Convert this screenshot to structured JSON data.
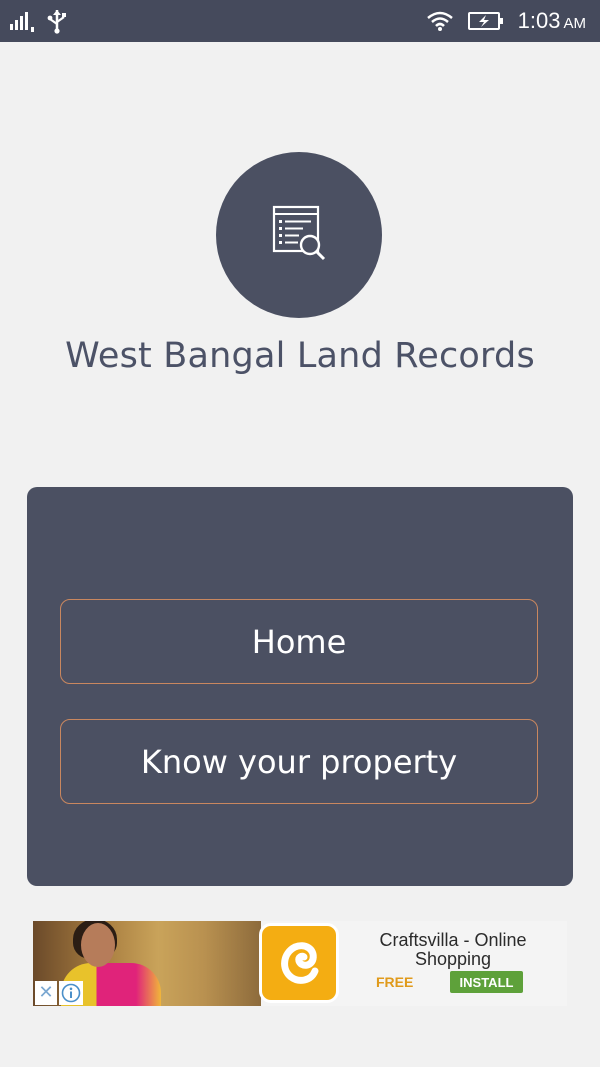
{
  "status_bar": {
    "time": "1:03",
    "ampm": "AM",
    "icons": [
      "signal-icon",
      "usb-icon",
      "wifi-icon",
      "battery-charging-icon"
    ]
  },
  "app": {
    "title": "West Bangal Land Records",
    "logo_icon": "document-search-icon"
  },
  "menu": {
    "home_label": "Home",
    "property_label": "Know your property"
  },
  "ad": {
    "app_name": "Craftsvilla - Online Shopping",
    "price": "FREE",
    "install_label": "INSTALL",
    "close_icon": "close-icon",
    "info_icon": "info-icon"
  },
  "colors": {
    "status_bar": "#454a5c",
    "card": "#4b5062",
    "button_border": "#c9875f",
    "title_text": "#4c5267",
    "background": "#f1f1f1",
    "install_button": "#5ea13a",
    "free_text": "#e09a1b"
  }
}
